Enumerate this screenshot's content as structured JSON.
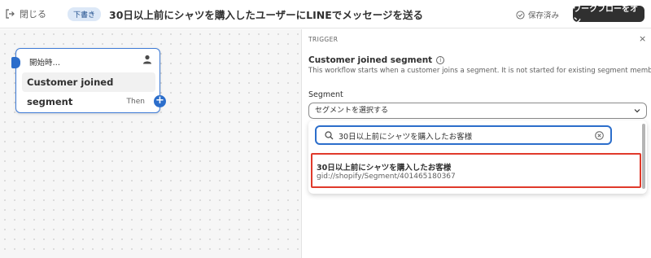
{
  "topbar": {
    "close_label": "閉じる",
    "draft_badge": "下書き",
    "title": "30日以上前にシャツを購入したユーザーにLINEでメッセージを送る",
    "saved_label": "保存済み",
    "turn_on_label": "ワークフローをオン"
  },
  "canvas": {
    "node": {
      "header": "開始時…",
      "name": "Customer joined segment",
      "then_label": "Then",
      "add_symbol": "+"
    }
  },
  "panel": {
    "section_label": "TRIGGER",
    "close_symbol": "×",
    "title": "Customer joined segment",
    "description": "This workflow starts when a customer joins a segment. It is not started for existing segment members.",
    "segment_label": "Segment",
    "segment_placeholder": "セグメントを選択する",
    "search_value": "30日以上前にシャツを購入したお客様",
    "result": {
      "name": "30日以上前にシャツを購入したお客様",
      "gid": "gid://shopify/Segment/401465180367"
    }
  },
  "icons": {
    "close": "exit-icon",
    "saved": "check-circle-icon",
    "person": "person-icon",
    "info": "info-icon",
    "chevron": "chevron-down-icon",
    "search": "search-icon",
    "clear": "clear-circle-icon"
  },
  "colors": {
    "accent": "#2c6ecb",
    "highlight_border": "#e03a2b",
    "primary_button": "#303030",
    "draft_badge_bg": "#dce8f7"
  }
}
